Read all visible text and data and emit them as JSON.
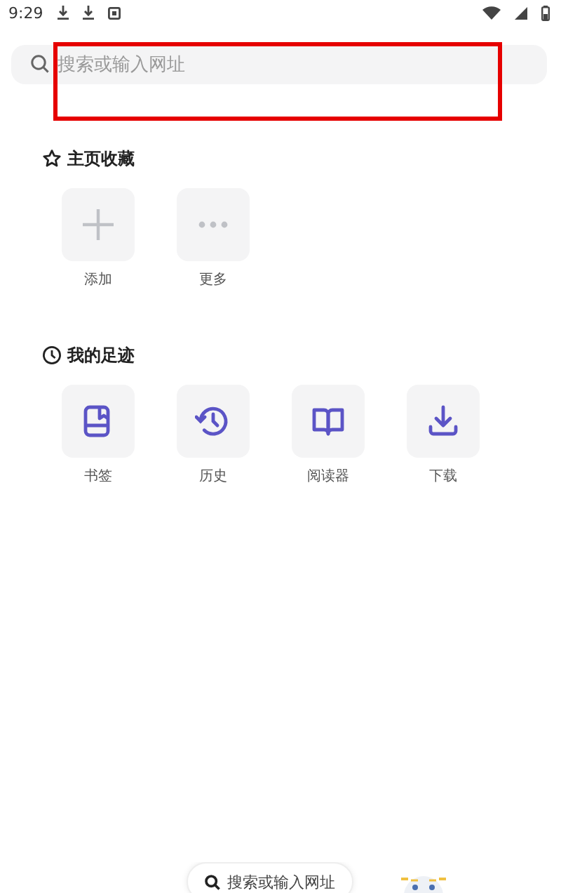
{
  "status_bar": {
    "time": "9:29"
  },
  "search": {
    "placeholder": "搜索或输入网址"
  },
  "sections": [
    {
      "title": "主页收藏",
      "kind": "star",
      "tiles": [
        {
          "label": "添加",
          "kind": "add"
        },
        {
          "label": "更多",
          "kind": "more"
        }
      ]
    },
    {
      "title": "我的足迹",
      "kind": "clock",
      "tiles": [
        {
          "label": "书签",
          "kind": "bookmark"
        },
        {
          "label": "历史",
          "kind": "history"
        },
        {
          "label": "阅读器",
          "kind": "reader"
        },
        {
          "label": "下载",
          "kind": "download"
        }
      ]
    }
  ],
  "bottom_bar": {
    "search_label": "搜索或输入网址"
  }
}
